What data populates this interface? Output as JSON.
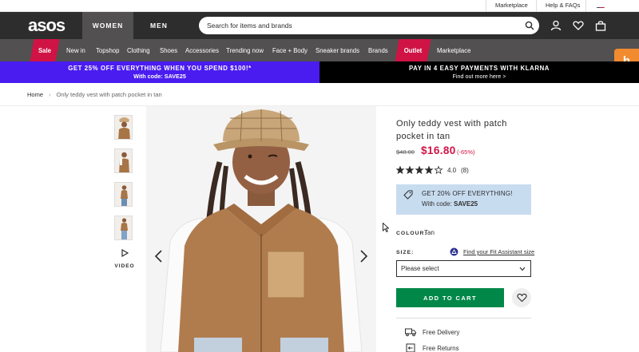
{
  "util": {
    "marketplace": "Marketplace",
    "help": "Help & FAQs"
  },
  "header": {
    "logo": "asos",
    "tabs": [
      "WOMEN",
      "MEN"
    ],
    "search_placeholder": "Search for items and brands",
    "icons": [
      "account-icon",
      "heart-icon",
      "bag-icon"
    ]
  },
  "nav": {
    "sale": "Sale",
    "items": [
      "New in",
      "Topshop",
      "Clothing",
      "Shoes",
      "Accessories",
      "Trending now",
      "Face + Body",
      "Sneaker brands",
      "Brands"
    ],
    "outlet": "Outlet",
    "marketplace": "Marketplace"
  },
  "promo": {
    "left_line1": "GET 25% OFF EVERYTHING WHEN YOU SPEND $100!*",
    "left_line2": "With code: SAVE25",
    "right_line1": "PAY IN 4 EASY PAYMENTS WITH KLARNA",
    "right_line2": "Find out more here >"
  },
  "widget": {
    "label": "h"
  },
  "breadcrumb": {
    "home": "Home",
    "sep": "›",
    "current": "Only teddy vest with patch pocket in tan"
  },
  "gallery": {
    "video_label": "VIDEO"
  },
  "product": {
    "title": "Only teddy vest with patch pocket in tan",
    "price_old": "$48.00",
    "price_now": "$16.80",
    "discount": "(-65%)",
    "rating": 4.0,
    "rating_text": "4.0",
    "rating_count": "(8)",
    "promo_line1": "GET 20% OFF EVERYTHING!",
    "promo_line2_prefix": "With code: ",
    "promo_code": "SAVE25",
    "colour_label": "COLOUR:",
    "colour_value": "Tan",
    "size_label": "SIZE:",
    "fit_link": "Find your Fit Assistant size",
    "size_value": "Please select",
    "add_to_cart": "ADD TO CART",
    "features": [
      "Free Delivery",
      "Free Returns"
    ]
  },
  "colors": {
    "header_bg": "#2d2d2d",
    "nav_bg": "#525050",
    "sale_red": "#d01345",
    "promo_purple": "#4a1cf0",
    "cta_green": "#018849",
    "promo_box": "#c8dcf0",
    "widget_orange": "#f28b30"
  }
}
